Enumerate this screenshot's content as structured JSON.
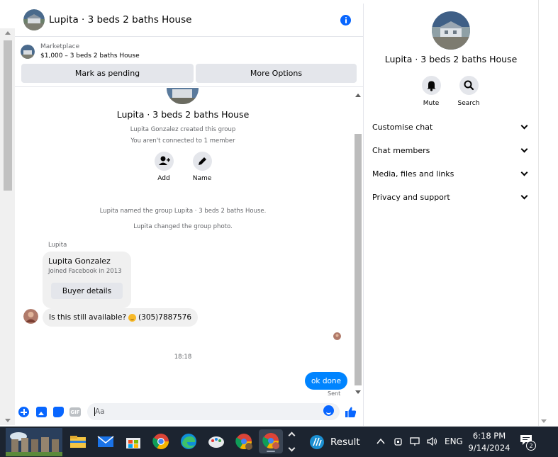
{
  "chat": {
    "title": "Lupita · 3 beds 2 baths House",
    "marketplace_label": "Marketplace",
    "listing": "$1,000 – 3 beds 2 baths House",
    "mark_pending": "Mark as pending",
    "more_options": "More Options",
    "group_title": "Lupita · 3 beds 2 baths House",
    "created_text": "Lupita Gonzalez created this group",
    "connected_text": "You aren't connected to 1 member",
    "actions": [
      {
        "label": "Add",
        "icon": "add-person-icon"
      },
      {
        "label": "Name",
        "icon": "pencil-icon"
      }
    ],
    "system_messages": [
      "Lupita named the group Lupita · 3 beds 2 baths House.",
      "Lupita changed the group photo."
    ],
    "sender_label": "Lupita",
    "profile_card": {
      "name": "Lupita Gonzalez",
      "joined": "Joined Facebook in 2013",
      "button": "Buyer details"
    },
    "incoming_message_pre": "Is this still available?",
    "incoming_message_post": "(305)7887576",
    "timestamp": "18:18",
    "outgoing_message": "ok done",
    "sent_status": "Sent",
    "composer_placeholder": "Aa",
    "accent_color": "#0866ff",
    "outgoing_bubble_color": "#0084ff"
  },
  "sidebar": {
    "title": "Lupita · 3 beds 2 baths House",
    "actions": [
      {
        "label": "Mute",
        "icon": "bell-icon"
      },
      {
        "label": "Search",
        "icon": "search-icon"
      }
    ],
    "sections": [
      {
        "label": "Customise chat"
      },
      {
        "label": "Chat members"
      },
      {
        "label": "Media, files and links"
      },
      {
        "label": "Privacy and support"
      }
    ]
  },
  "taskbar": {
    "result_label": "Result",
    "language": "ENG",
    "time": "6:18 PM",
    "date": "9/14/2024",
    "notification_count": "2"
  }
}
